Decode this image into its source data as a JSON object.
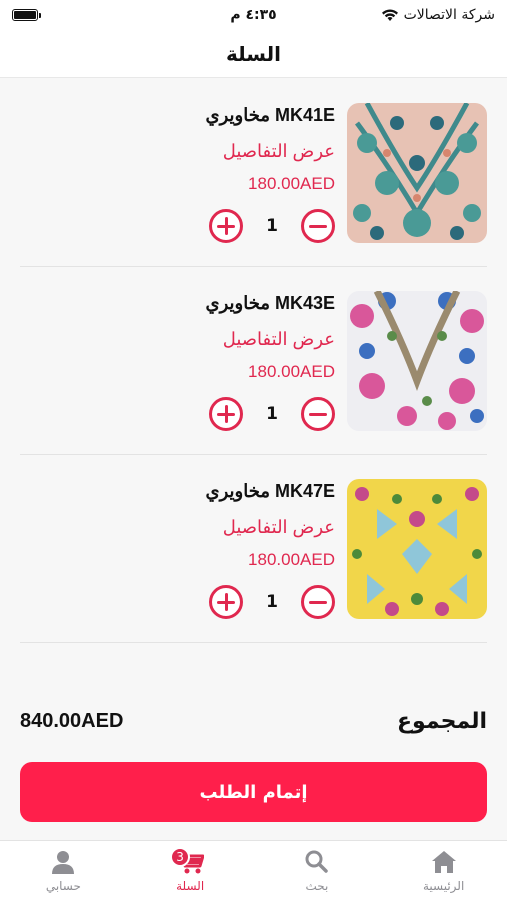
{
  "status_bar": {
    "time": "٤:٣٥ م",
    "carrier": "شركة الاتصالات"
  },
  "header": {
    "title": "السلة"
  },
  "cart": {
    "items": [
      {
        "name": "مخاويري MK41E",
        "details_label": "عرض التفاصيل",
        "price": "180.00AED",
        "quantity": "1",
        "pattern": "teal-floral-on-pink"
      },
      {
        "name": "مخاويري MK43E",
        "details_label": "عرض التفاصيل",
        "price": "180.00AED",
        "quantity": "1",
        "pattern": "pink-blue-floral-on-white"
      },
      {
        "name": "مخاويري MK47E",
        "details_label": "عرض التفاصيل",
        "price": "180.00AED",
        "quantity": "1",
        "pattern": "butterflies-on-yellow"
      }
    ]
  },
  "total": {
    "label": "المجموع",
    "value": "840.00AED"
  },
  "checkout": {
    "label": "إتمام الطلب"
  },
  "tabs": [
    {
      "label": "حسابي",
      "icon": "person-icon",
      "active": false
    },
    {
      "label": "السلة",
      "icon": "cart-icon",
      "active": true,
      "badge": "3"
    },
    {
      "label": "بحث",
      "icon": "search-icon",
      "active": false
    },
    {
      "label": "الرئيسية",
      "icon": "home-icon",
      "active": false
    }
  ],
  "colors": {
    "accent": "#e0284f",
    "checkout": "#ff1f4b",
    "tab_inactive": "#8e8e93"
  }
}
